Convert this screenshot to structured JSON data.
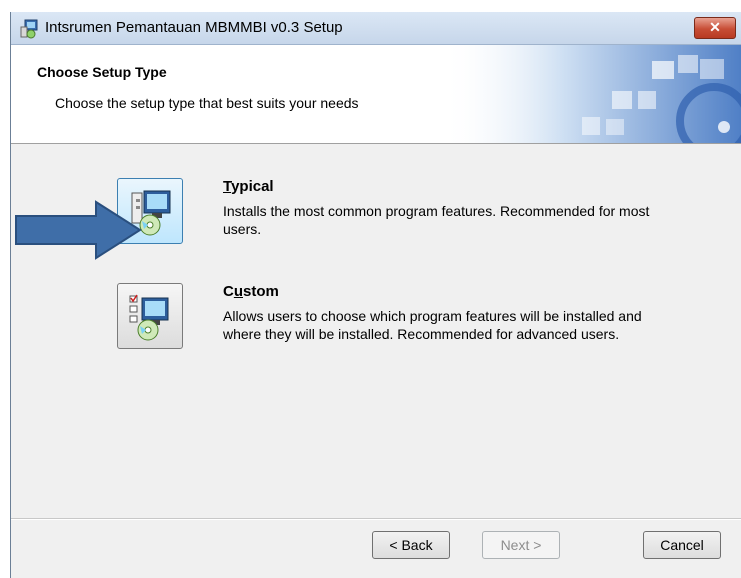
{
  "window": {
    "title": "Intsrumen Pemantauan MBMMBI v0.3 Setup",
    "close_label": "✕"
  },
  "header": {
    "title": "Choose Setup Type",
    "subtitle": "Choose the setup type that best suits your needs"
  },
  "options": [
    {
      "label_first": "T",
      "label_rest": "ypical",
      "description": "Installs the most common program features. Recommended for most users."
    },
    {
      "label_first": "C",
      "label_mid_u": "u",
      "label_rest": "stom",
      "description": "Allows users to choose which program features will be installed and where they will be installed. Recommended for advanced users."
    }
  ],
  "footer": {
    "back_label": "< Back",
    "next_label": "Next >",
    "cancel_label": "Cancel"
  },
  "colors": {
    "annotation_arrow": "#3f6ea8",
    "close_button": "#c74d36"
  }
}
